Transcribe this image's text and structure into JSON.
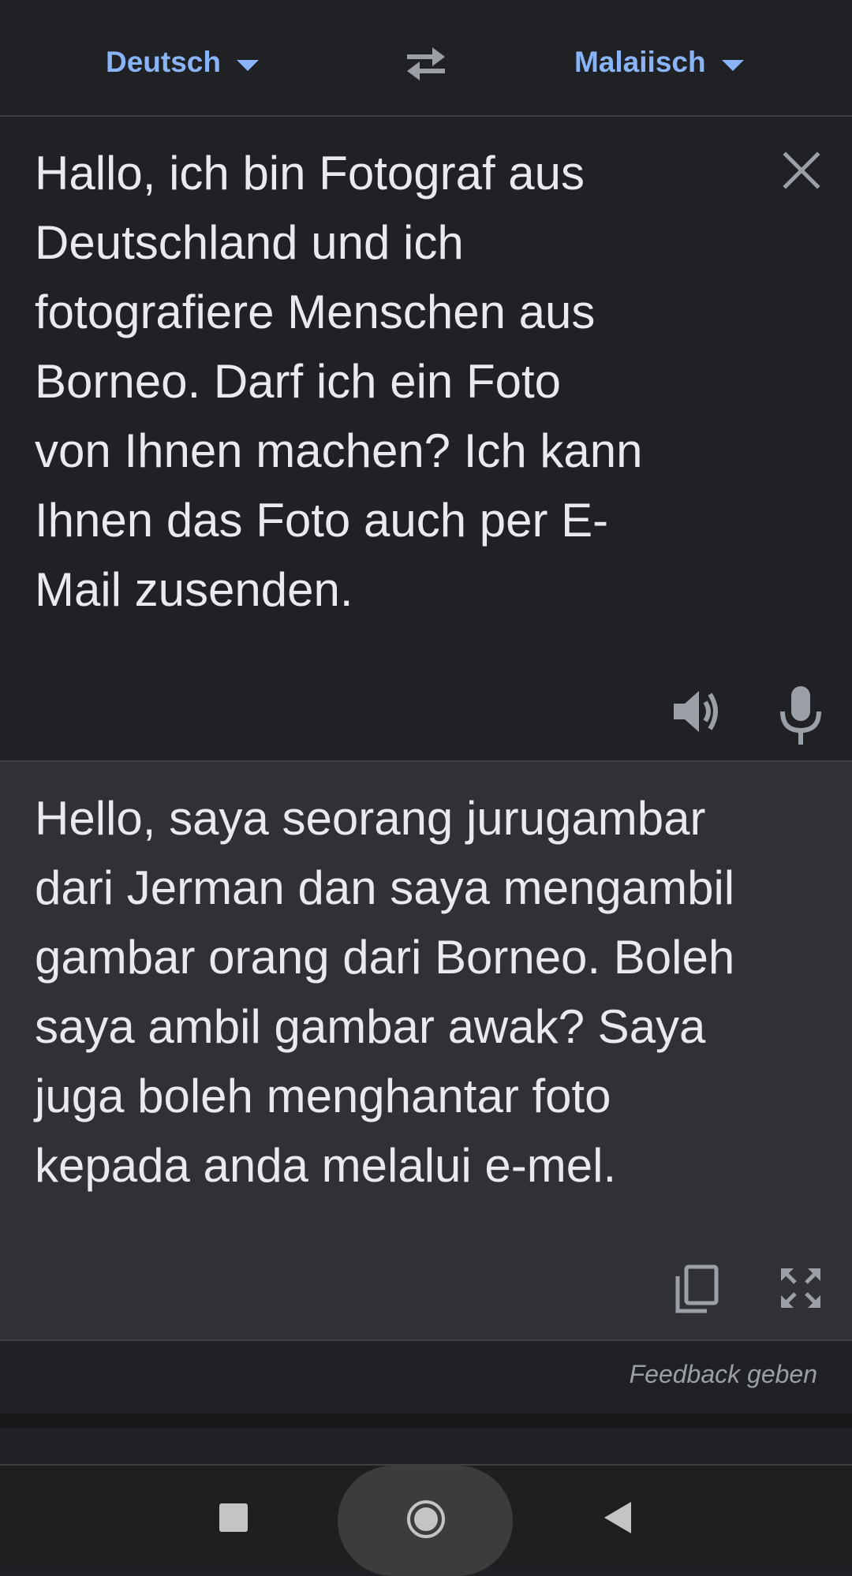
{
  "language_bar": {
    "source_language": "Deutsch",
    "target_language": "Malaiisch"
  },
  "source": {
    "lines": [
      "Hallo, ich bin Fotograf aus",
      "Deutschland und ich",
      "fotografiere Menschen aus",
      "Borneo. Darf ich ein Foto",
      "von Ihnen machen? Ich kann",
      "Ihnen das Foto auch per E-",
      "Mail zusenden."
    ]
  },
  "translation": {
    "lines": [
      "Hello, saya seorang jurugambar",
      "dari Jerman dan saya mengambil",
      "gambar orang dari Borneo. Boleh",
      "saya ambil gambar awak? Saya",
      "juga boleh menghantar foto",
      "kepada anda melalui e-mel."
    ]
  },
  "feedback": {
    "label": "Feedback geben"
  },
  "icons": {
    "swap": "swap-languages-icon",
    "clear": "close-icon",
    "speaker": "speaker-icon",
    "mic": "microphone-icon",
    "copy": "copy-icon",
    "fullscreen": "fullscreen-icon"
  },
  "colors": {
    "accent": "#8ab4f8",
    "background": "#202124",
    "translation_background": "#303134",
    "text": "#e8eaed",
    "muted": "#9aa0a6"
  }
}
